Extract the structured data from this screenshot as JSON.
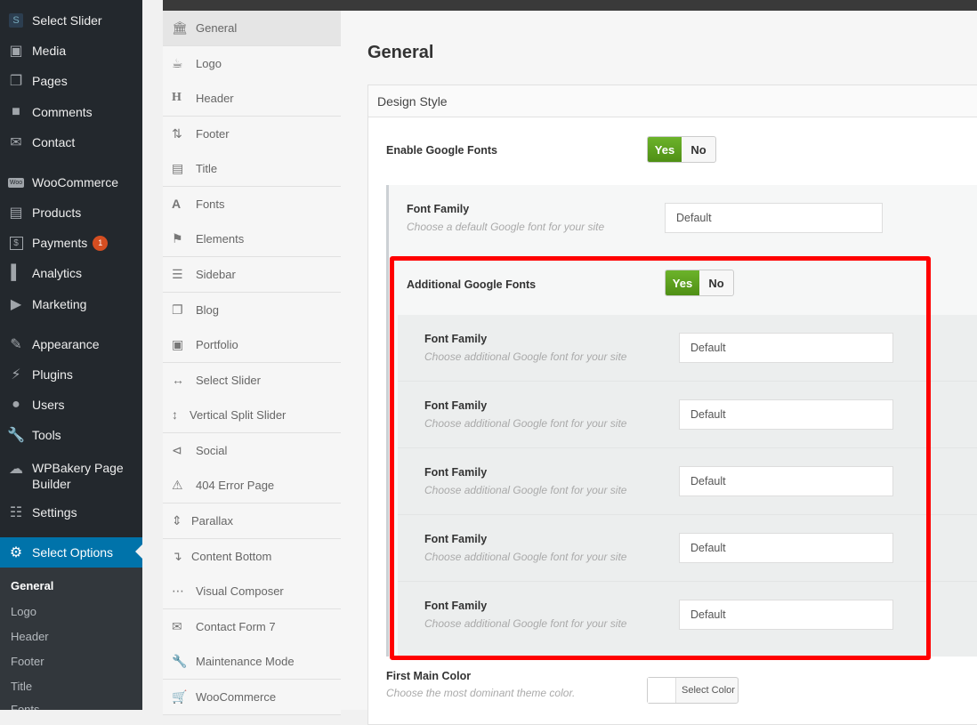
{
  "wp_menu": [
    {
      "label": "Select Slider",
      "icon": "select-slider-icon"
    },
    {
      "label": "Media",
      "icon": "media-icon"
    },
    {
      "label": "Pages",
      "icon": "pages-icon"
    },
    {
      "label": "Comments",
      "icon": "comments-icon"
    },
    {
      "label": "Contact",
      "icon": "mail-icon"
    },
    {
      "label": "WooCommerce",
      "icon": "woo-icon"
    },
    {
      "label": "Products",
      "icon": "archive-icon"
    },
    {
      "label": "Payments",
      "icon": "dollar-icon",
      "badge": "1"
    },
    {
      "label": "Analytics",
      "icon": "chart-icon"
    },
    {
      "label": "Marketing",
      "icon": "megaphone-icon"
    },
    {
      "label": "Appearance",
      "icon": "brush-icon"
    },
    {
      "label": "Plugins",
      "icon": "plug-icon"
    },
    {
      "label": "Users",
      "icon": "user-icon"
    },
    {
      "label": "Tools",
      "icon": "wrench-icon"
    },
    {
      "label": "WPBakery Page Builder",
      "icon": "wpbakery-icon"
    },
    {
      "label": "Settings",
      "icon": "settings-icon"
    },
    {
      "label": "Select Options",
      "icon": "gear-icon"
    }
  ],
  "wp_submenu": [
    "General",
    "Logo",
    "Header",
    "Footer",
    "Title",
    "Fonts"
  ],
  "options_nav": [
    {
      "label": "General",
      "icon": "bank-icon"
    },
    {
      "label": "Logo",
      "icon": "cup-icon"
    },
    {
      "label": "Header",
      "icon": "header-icon"
    },
    {
      "label": "Footer",
      "icon": "footer-icon"
    },
    {
      "label": "Title",
      "icon": "title-icon"
    },
    {
      "label": "Fonts",
      "icon": "font-icon"
    },
    {
      "label": "Elements",
      "icon": "flag-icon"
    },
    {
      "label": "Sidebar",
      "icon": "menu-icon"
    },
    {
      "label": "Blog",
      "icon": "blog-icon"
    },
    {
      "label": "Portfolio",
      "icon": "camera-icon"
    },
    {
      "label": "Select Slider",
      "icon": "arrows-h-icon"
    },
    {
      "label": "Vertical Split Slider",
      "icon": "arrows-v-icon"
    },
    {
      "label": "Social",
      "icon": "share-icon"
    },
    {
      "label": "404 Error Page",
      "icon": "warning-icon"
    },
    {
      "label": "Parallax",
      "icon": "sort-icon"
    },
    {
      "label": "Content Bottom",
      "icon": "arrow-down-icon"
    },
    {
      "label": "Visual Composer",
      "icon": "ellipsis-icon"
    },
    {
      "label": "Contact Form 7",
      "icon": "envelope-icon"
    },
    {
      "label": "Maintenance Mode",
      "icon": "wrench-icon"
    },
    {
      "label": "WooCommerce",
      "icon": "cart-icon"
    }
  ],
  "page": {
    "title": "General",
    "panel_title": "Design Style",
    "enable_google_fonts": {
      "label": "Enable Google Fonts",
      "yes": "Yes",
      "no": "No"
    },
    "font_family": {
      "label": "Font Family",
      "desc": "Choose a default Google font for your site",
      "value": "Default"
    },
    "additional_fonts": {
      "label": "Additional Google Fonts",
      "yes": "Yes",
      "no": "No"
    },
    "additional_rows": [
      {
        "label": "Font Family",
        "desc": "Choose additional Google font for your site",
        "value": "Default"
      },
      {
        "label": "Font Family",
        "desc": "Choose additional Google font for your site",
        "value": "Default"
      },
      {
        "label": "Font Family",
        "desc": "Choose additional Google font for your site",
        "value": "Default"
      },
      {
        "label": "Font Family",
        "desc": "Choose additional Google font for your site",
        "value": "Default"
      },
      {
        "label": "Font Family",
        "desc": "Choose additional Google font for your site",
        "value": "Default"
      }
    ],
    "first_main_color": {
      "label": "First Main Color",
      "desc": "Choose the most dominant theme color.",
      "button": "Select Color"
    }
  },
  "colors": {
    "sidebar_bg": "#23282d",
    "current_menu": "#0073aa",
    "toggle_yes": "#5aa21b",
    "highlight": "#ff0000"
  }
}
